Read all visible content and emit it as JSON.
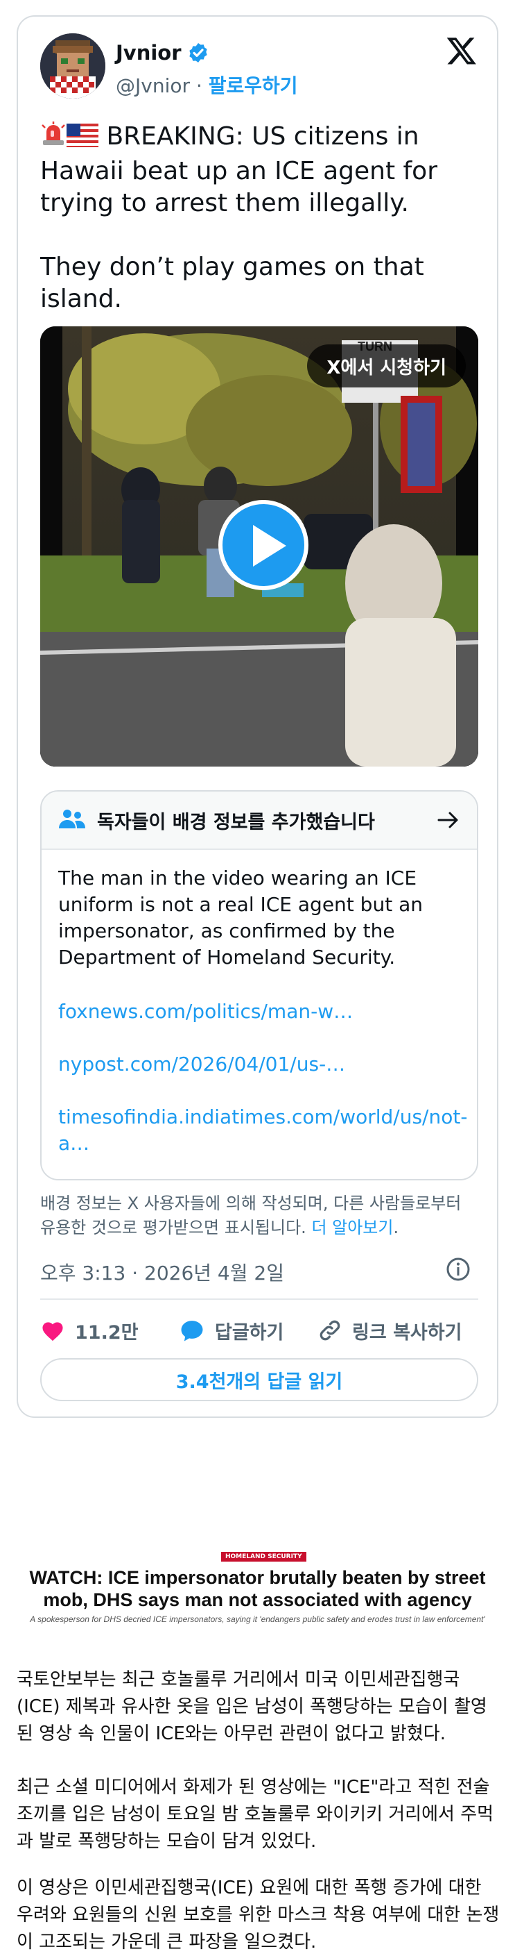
{
  "tweet": {
    "author_name": "Jvnior",
    "handle": "@Jvnior",
    "separator": " · ",
    "follow_label": "팔로우하기",
    "text": " BREAKING: US citizens in Hawaii beat up an ICE agent for trying to arrest them illegally.\n\nThey don’t play games on that island.",
    "media": {
      "watch_label": "X에서 시청하기",
      "sign_text": "TURN"
    },
    "community_note": {
      "header": "독자들이 배경 정보를 추가했습니다",
      "body": "The man in the video wearing an ICE uniform is not a real ICE agent but an impersonator, as confirmed by the Department of Homeland Security.",
      "links": [
        "foxnews.com/politics/man-w…",
        "nypost.com/2026/04/01/us-…",
        "timesofindia.indiatimes.com/world/us/not-a…"
      ]
    },
    "disclaimer_text": "배경 정보는 X 사용자들에 의해 작성되며, 다른 사람들로부터 유용한 것으로 평가받으면 표시됩니다. ",
    "learn_more": "더 알아보기",
    "timestamp": "오후 3:13 · 2026년 4월 2일",
    "actions": {
      "likes": "11.2만",
      "reply": "답글하기",
      "copy_link": "링크 복사하기"
    },
    "read_replies": "3.4천개의 답글 읽기"
  },
  "article": {
    "tag": "HOMELAND SECURITY",
    "headline": "WATCH: ICE impersonator brutally beaten by street mob, DHS says man not associated with agency",
    "subhead": "A spokesperson for DHS decried ICE impersonators, saying it 'endangers public safety and erodes trust in law enforcement'",
    "paragraphs": [
      "국토안보부는 최근 호놀룰루 거리에서 미국 이민세관집행국(ICE) 제복과 유사한 옷을 입은 남성이 폭행당하는 모습이 촬영된 영상 속 인물이 ICE와는 아무런 관련이 없다고 밝혔다.",
      "최근 소셜 미디어에서 화제가 된 영상에는 \"ICE\"라고 적힌 전술 조끼를 입은 남성이 토요일 밤 호놀룰루 와이키키 거리에서 주먹과 발로 폭행당하는 모습이 담겨 있었다.",
      "이 영상은 이민세관집행국(ICE) 요원에 대한 폭행 증가에 대한 우려와 요원들의 신원 보호를 위한 마스크 착용 여부에 대한 논쟁이 고조되는 가운데 큰 파장을 일으켰다."
    ]
  },
  "colors": {
    "accent": "#1d9bf0",
    "like": "#f91880",
    "text_secondary": "#536471",
    "border": "#d8dde1",
    "tag_red": "#c8102e"
  },
  "icons": [
    "verified-badge-icon",
    "x-logo-icon",
    "siren-emoji-icon",
    "us-flag-emoji-icon",
    "play-icon",
    "people-icon",
    "arrow-right-icon",
    "info-icon",
    "heart-icon",
    "reply-bubble-icon",
    "link-icon"
  ]
}
